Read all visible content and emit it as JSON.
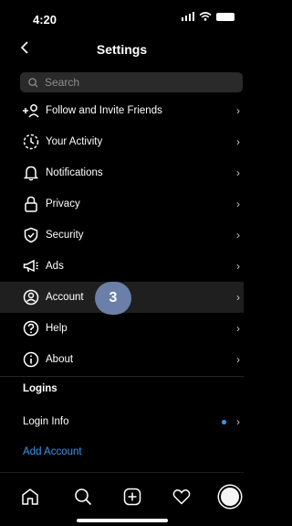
{
  "status_bar": {
    "time": "4:20"
  },
  "header": {
    "title": "Settings",
    "back_icon": "chevron-left-icon"
  },
  "search": {
    "placeholder": "Search"
  },
  "menu": [
    {
      "label": "Follow and Invite Friends",
      "icon": "add-person-icon"
    },
    {
      "label": "Your Activity",
      "icon": "activity-icon"
    },
    {
      "label": "Notifications",
      "icon": "bell-icon"
    },
    {
      "label": "Privacy",
      "icon": "lock-icon"
    },
    {
      "label": "Security",
      "icon": "shield-icon"
    },
    {
      "label": "Ads",
      "icon": "megaphone-icon"
    },
    {
      "label": "Account",
      "icon": "account-icon"
    },
    {
      "label": "Help",
      "icon": "help-icon"
    },
    {
      "label": "About",
      "icon": "info-icon"
    }
  ],
  "badge": "3",
  "logins": {
    "title": "Logins",
    "login_info": "Login Info",
    "add_account": "Add Account"
  },
  "colors": {
    "accent": "#3897f0",
    "badge": "#6b7fa8",
    "background": "#000000"
  },
  "tabbar": [
    "home-icon",
    "search-icon",
    "create-icon",
    "heart-icon",
    "profile-avatar"
  ]
}
